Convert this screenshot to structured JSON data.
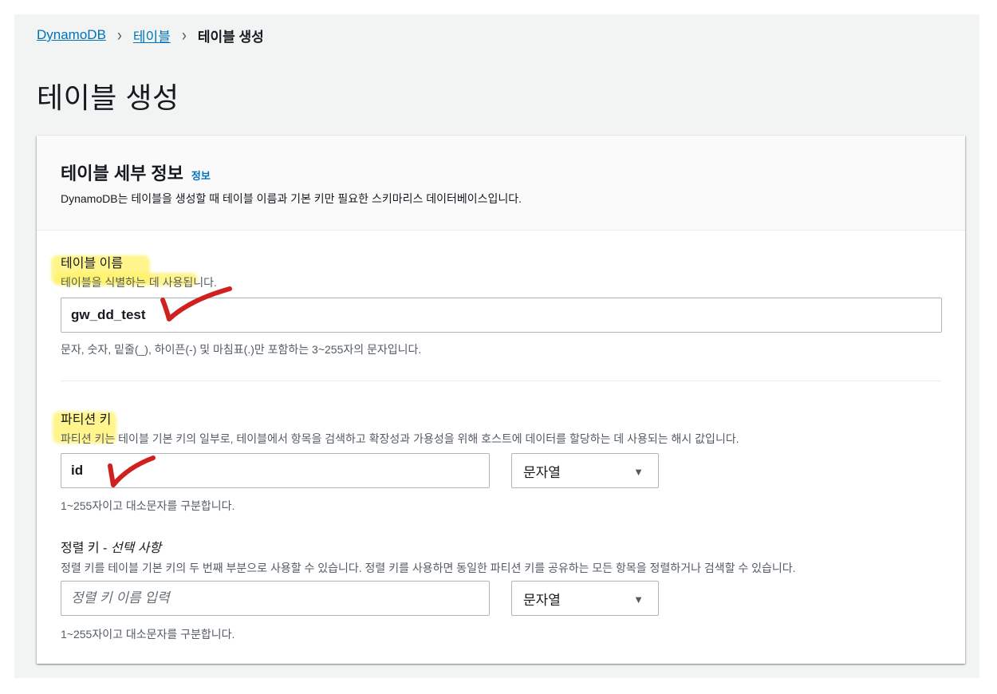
{
  "breadcrumb": {
    "root": "DynamoDB",
    "parent": "테이블",
    "current": "테이블 생성",
    "separator": "›"
  },
  "page": {
    "title": "테이블 생성"
  },
  "card": {
    "title": "테이블 세부 정보",
    "info_link": "정보",
    "description": "DynamoDB는 테이블을 생성할 때 테이블 이름과 기본 키만 필요한 스키마리스 데이터베이스입니다."
  },
  "table_name": {
    "label": "테이블 이름",
    "description": "테이블을 식별하는 데 사용됩니다.",
    "value": "gw_dd_test",
    "constraint": "문자, 숫자, 밑줄(_), 하이픈(-) 및 마침표(.)만 포함하는 3~255자의 문자입니다."
  },
  "partition_key": {
    "label": "파티션 키",
    "description": "파티션 키는 테이블 기본 키의 일부로, 테이블에서 항목을 검색하고 확장성과 가용성을 위해 호스트에 데이터를 할당하는 데 사용되는 해시 값입니다.",
    "value": "id",
    "type_selected": "문자열",
    "constraint": "1~255자이고 대소문자를 구분합니다."
  },
  "sort_key": {
    "label": "정렬 키 - ",
    "label_optional": "선택 사항",
    "description": "정렬 키를 테이블 기본 키의 두 번째 부분으로 사용할 수 있습니다. 정렬 키를 사용하면 동일한 파티션 키를 공유하는 모든 항목을 정렬하거나 검색할 수 있습니다.",
    "placeholder": "정렬 키 이름 입력",
    "type_selected": "문자열",
    "constraint": "1~255자이고 대소문자를 구분합니다."
  },
  "icons": {
    "caret": "▼",
    "checkmark": "red-checkmark-annotation"
  },
  "colors": {
    "link": "#0073bb",
    "highlight": "#fff266",
    "annotation": "#d0201f"
  }
}
